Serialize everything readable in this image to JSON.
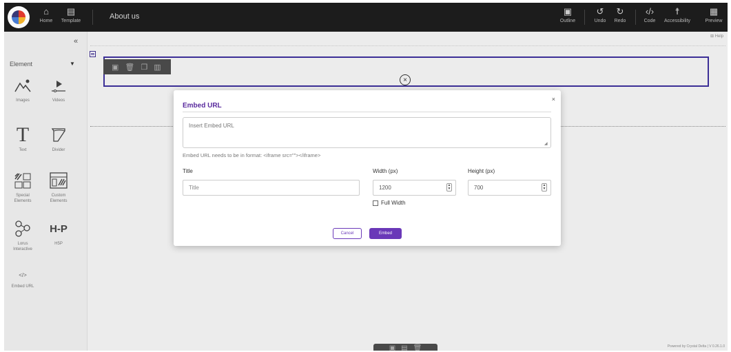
{
  "topbar": {
    "home_label": "Home",
    "template_label": "Template",
    "page_title": "About us",
    "outline_label": "Outline",
    "undo_label": "Undo",
    "redo_label": "Redo",
    "code_label": "Code",
    "accessibility_label": "Accessibility",
    "preview_label": "Preview"
  },
  "sidebar": {
    "collapse_glyph": "«",
    "dropdown_label": "Element",
    "tiles": [
      {
        "label": "Images",
        "icon": "image-icon"
      },
      {
        "label": "Videos",
        "icon": "video-icon"
      },
      {
        "label": "Text",
        "icon": "text-icon"
      },
      {
        "label": "Divider",
        "icon": "divider-icon"
      },
      {
        "label": "Special\nElements",
        "icon": "special-elements-icon"
      },
      {
        "label": "Custom\nElements",
        "icon": "custom-elements-icon"
      },
      {
        "label": "Lorus\nInteractive",
        "icon": "lorus-interactive-icon"
      },
      {
        "label": "H5P",
        "icon": "h5p-icon"
      },
      {
        "label": "Embed URL",
        "icon": "embed-code-icon",
        "glyph": "</>"
      }
    ]
  },
  "canvas": {
    "help_label": "Help",
    "powered_text": "Powered by Crystal Delta  |  V 0.26.1.0"
  },
  "modal": {
    "title": "Embed URL",
    "close_glyph": "×",
    "url_placeholder": "Insert Embed URL",
    "hint": "Embed URL needs to be in format: <iframe src=\"\"></iframe>",
    "title_label": "Title",
    "title_placeholder": "Title",
    "width_label": "Width (px)",
    "width_value": "1200",
    "height_label": "Height (px)",
    "height_value": "700",
    "full_width_label": "Full Width",
    "cancel_label": "Cancel",
    "embed_label": "Embed"
  },
  "colors": {
    "accent": "#6a38b8",
    "row_border": "#3d2f9a",
    "topbar_bg": "#1d1d1d"
  }
}
